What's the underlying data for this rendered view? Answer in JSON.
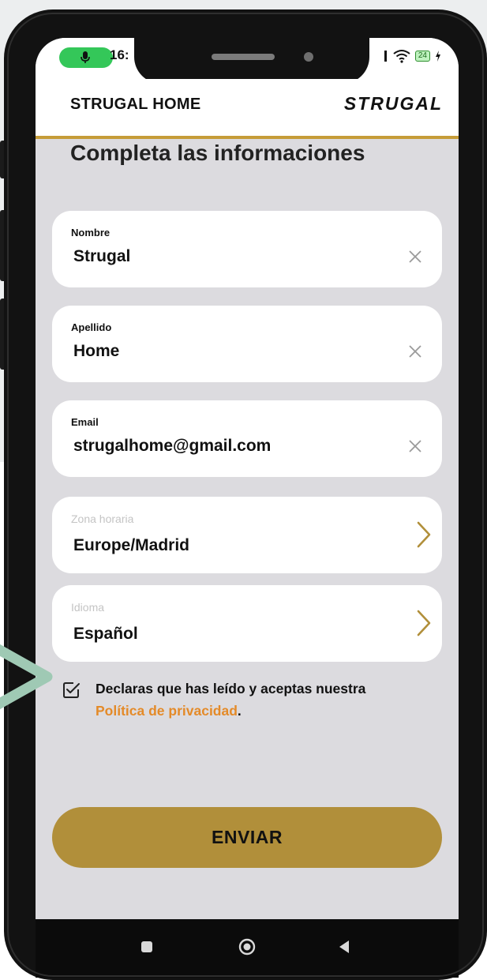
{
  "status_bar": {
    "time": "16:",
    "battery": "24"
  },
  "app_bar": {
    "title": "STRUGAL HOME",
    "brand": "STRUGAL"
  },
  "page": {
    "heading": "Completa las informaciones"
  },
  "form": {
    "fields": [
      {
        "label": "Nombre",
        "value": "Strugal",
        "action_icon": "clear-icon"
      },
      {
        "label": "Apellido",
        "value": "Home",
        "action_icon": "clear-icon"
      },
      {
        "label": "Email",
        "value": "strugalhome@gmail.com",
        "action_icon": "clear-icon"
      },
      {
        "label": "Zona horaria",
        "value": "Europe/Madrid",
        "action_icon": "chevron-right-icon"
      },
      {
        "label": "Idioma",
        "value": "Español",
        "action_icon": "chevron-right-icon"
      }
    ],
    "consent": {
      "checked": true,
      "text": "Declaras que has leído y aceptas nuestra",
      "link": "Política de privacidad",
      "suffix": "."
    },
    "submit_label": "ENVIAR"
  },
  "nav_bar": {
    "icons": [
      "recents-icon",
      "home-icon",
      "back-icon"
    ]
  },
  "colors": {
    "accent": "#b18f3a",
    "accent_line": "#c69c38",
    "link": "#e48a28",
    "screen_bg": "#dcdbdf",
    "mic_indicator": "#34c759",
    "decorative_arrow": "#9fc9b4"
  }
}
